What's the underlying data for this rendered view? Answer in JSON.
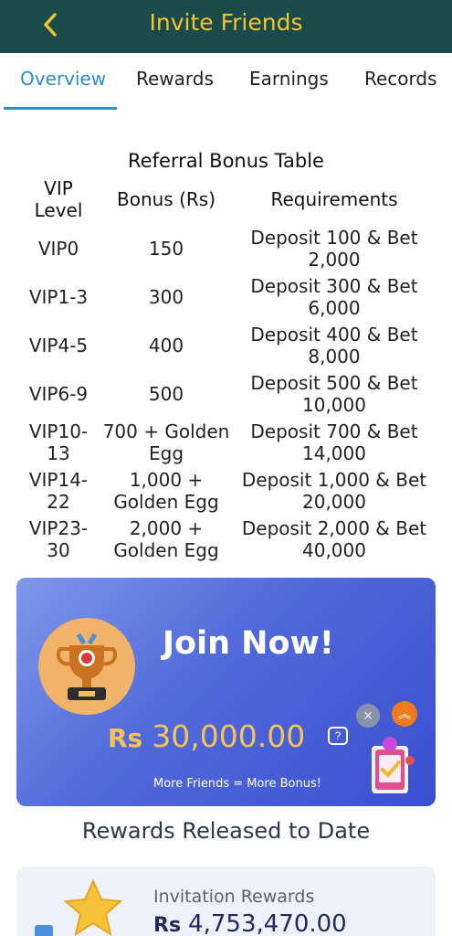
{
  "header": {
    "title": "Invite Friends",
    "back_icon": "chevron-left-icon"
  },
  "tabs": [
    {
      "label": "Overview",
      "active": true
    },
    {
      "label": "Rewards",
      "active": false
    },
    {
      "label": "Earnings",
      "active": false
    },
    {
      "label": "Records",
      "active": false
    }
  ],
  "bonus_table": {
    "title": "Referral Bonus Table",
    "columns": [
      "VIP Level",
      "Bonus (Rs)",
      "Requirements"
    ],
    "rows": [
      {
        "level": "VIP0",
        "bonus": "150",
        "requirement": "Deposit 100 & Bet 2,000"
      },
      {
        "level": "VIP1-3",
        "bonus": "300",
        "requirement": "Deposit 300 & Bet 6,000"
      },
      {
        "level": "VIP4-5",
        "bonus": "400",
        "requirement": "Deposit 400 & Bet 8,000"
      },
      {
        "level": "VIP6-9",
        "bonus": "500",
        "requirement": "Deposit 500 & Bet 10,000"
      },
      {
        "level": "VIP10-13",
        "bonus": "700 + Golden Egg",
        "requirement": "Deposit 700 & Bet 14,000"
      },
      {
        "level": "VIP14-22",
        "bonus": "1,000 + Golden Egg",
        "requirement": "Deposit 1,000 & Bet 20,000"
      },
      {
        "level": "VIP23-30",
        "bonus": "2,000 + Golden Egg",
        "requirement": "Deposit 2,000 & Bet 40,000"
      }
    ]
  },
  "banner": {
    "heading": "Join Now!",
    "currency": "Rs",
    "amount": "30,000.00",
    "tagline": "More Friends = More Bonus!",
    "icons": [
      "trophy-icon",
      "help-icon",
      "close-icon",
      "chevron-up-icon",
      "gift-icon"
    ]
  },
  "rewards_section": {
    "title": "Rewards Released to Date",
    "card": {
      "label": "Invitation Rewards",
      "currency": "Rs",
      "value": "4,753,470.00"
    }
  },
  "colors": {
    "header_bg": "#1b4a4b",
    "title": "#f2c52c",
    "tab_active": "#2b8fc4",
    "banner_start": "#7f97ea",
    "banner_end": "#3b4fcf",
    "amount": "#f5c35a"
  }
}
